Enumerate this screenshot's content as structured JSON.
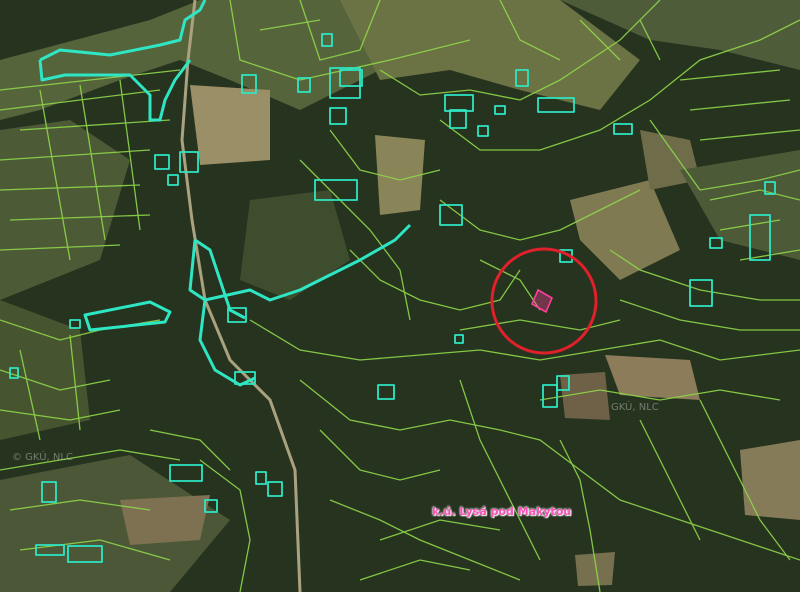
{
  "map": {
    "cadastral_label": "k.ú. Lysá pod Makytou",
    "watermarks": [
      "© GKÚ, NLC",
      "GKÚ, NLC"
    ],
    "colors": {
      "forest": "#24331f",
      "field": "#58663f",
      "meadow": "#8e8c5f",
      "parcel_lines": "#8fd64a",
      "highlight_lines": "#2ee6c3",
      "target_circle": "#e0202a",
      "target_parcel": "#ff3d9a",
      "label": "#ff4fb8"
    }
  }
}
